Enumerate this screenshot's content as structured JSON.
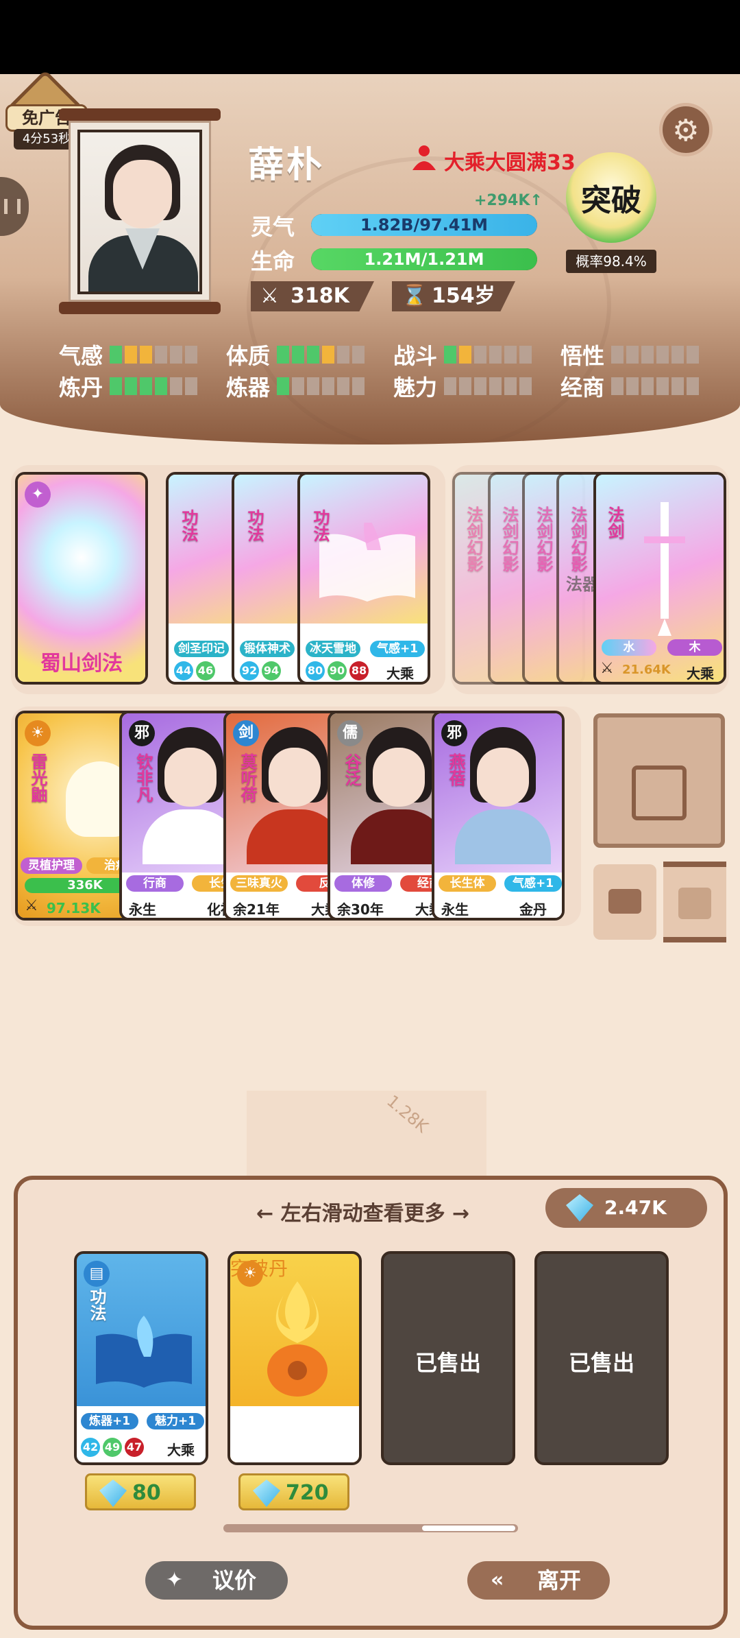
{
  "ad_badge": {
    "label": "免广告",
    "timer": "4分53秒"
  },
  "player": {
    "name": "薛朴",
    "realm": "大乘大圆满33",
    "lingqi_label": "灵气",
    "lingqi_value": "1.82B/97.41M",
    "lingqi_gain": "+294K↑",
    "life_label": "生命",
    "life_value": "1.21M/1.21M",
    "lingqi_fill_pct": 100,
    "life_fill_pct": 100,
    "power": "318K",
    "age": "154岁"
  },
  "breakthrough": {
    "label": "突破",
    "probability": "概率98.4%"
  },
  "attributes": [
    {
      "name": "气感",
      "filled": 3,
      "colors": [
        "#4fc86a",
        "#f2b43b",
        "#f2b43b"
      ]
    },
    {
      "name": "体质",
      "filled": 4,
      "colors": [
        "#4fc86a",
        "#4fc86a",
        "#4fc86a",
        "#f2b43b"
      ]
    },
    {
      "name": "战斗",
      "filled": 2,
      "colors": [
        "#4fc86a",
        "#f2b43b"
      ]
    },
    {
      "name": "悟性",
      "filled": 0,
      "colors": []
    },
    {
      "name": "炼丹",
      "filled": 4,
      "colors": [
        "#4fc86a",
        "#4fc86a",
        "#4fc86a",
        "#4fc86a"
      ]
    },
    {
      "name": "炼器",
      "filled": 1,
      "colors": [
        "#4fc86a"
      ]
    },
    {
      "name": "魅力",
      "filled": 0,
      "colors": []
    },
    {
      "name": "经商",
      "filled": 0,
      "colors": []
    }
  ],
  "technique_cards": {
    "main": {
      "title": "蜀山剑法"
    },
    "stack": [
      {
        "kind": "功法",
        "tags": [
          "剑圣印记"
        ],
        "dots": [
          "44",
          "46"
        ]
      },
      {
        "kind": "功法",
        "tags": [
          "锻体神术"
        ],
        "dots": [
          "92",
          "94"
        ]
      },
      {
        "kind": "功法",
        "tags": [
          "冰天雪地",
          "气感+1"
        ],
        "dots": [
          "80",
          "90",
          "88"
        ],
        "rank": "大乘"
      }
    ]
  },
  "weapon_cards": {
    "ghosts": [
      "法剑幻影",
      "法剑幻影",
      "法剑幻影",
      "法剑幻影"
    ],
    "ghost_overlay": "法器",
    "main": {
      "kind": "法剑",
      "elements": [
        "水",
        "木"
      ],
      "power": "21.64K",
      "rank": "大乘"
    }
  },
  "companions": [
    {
      "name": "雷光鼬",
      "tags": [
        "灵植护理",
        "治疗"
      ],
      "hp": "336K",
      "power": "97.13K"
    },
    {
      "badge": "邪",
      "name": "钦非凡",
      "tags": [
        "行商",
        "长生"
      ],
      "life": "永生",
      "rank": "化神"
    },
    {
      "badge": "剑",
      "name": "莫听荷",
      "tags": [
        "三味真火",
        "反"
      ],
      "life": "余21年",
      "rank": "大乘"
    },
    {
      "badge": "儒",
      "name": "谷泛",
      "tags": [
        "体修",
        "经商"
      ],
      "life": "余30年",
      "rank": "大乘"
    },
    {
      "badge": "邪",
      "name": "燕蓓",
      "tags": [
        "长生体",
        "气感+1"
      ],
      "life": "永生",
      "rank": "金丹"
    }
  ],
  "background_bits": {
    "gem_value": "1.28K"
  },
  "shop": {
    "hint": "← 左右滑动查看更多 →",
    "gems": "2.47K",
    "items": [
      {
        "kind": "功法",
        "tags": [
          "炼器+1",
          "魅力+1"
        ],
        "dots": [
          "42",
          "49",
          "47"
        ],
        "rank": "大乘",
        "price": "80"
      },
      {
        "title": "突破丹",
        "price": "720"
      },
      {
        "sold": "已售出"
      },
      {
        "sold": "已售出"
      }
    ],
    "negotiate": "议价",
    "leave": "离开"
  }
}
